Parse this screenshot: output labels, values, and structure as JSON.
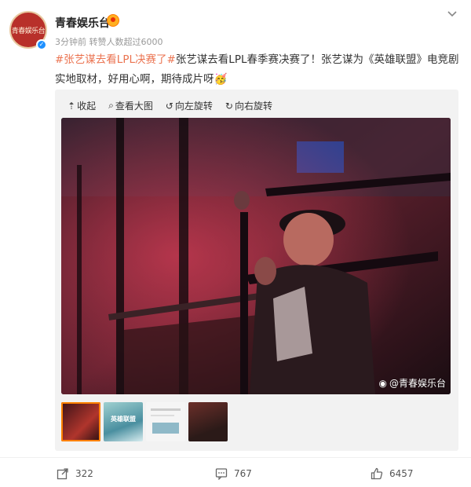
{
  "post": {
    "avatar_text": "青春娱乐台",
    "username": "青春娱乐台",
    "meta": "3分钟前 转赞人数超过6000",
    "hashtag": "#张艺谋去看LPL决赛了#",
    "text": "张艺谋去看LPL春季赛决赛了！张艺谋为《英雄联盟》电竞剧实地取材，好用心啊，期待成片呀"
  },
  "media": {
    "toolbar": {
      "collapse": "收起",
      "view_large": "查看大图",
      "rotate_left": "向左旋转",
      "rotate_right": "向右旋转"
    },
    "watermark": "@青春娱乐台",
    "thumb2_text": "英雄联盟"
  },
  "actions": {
    "repost_count": "322",
    "comment_count": "767",
    "like_count": "6457"
  },
  "colors": {
    "hashtag": "#eb7350",
    "accent": "#ff8200"
  }
}
